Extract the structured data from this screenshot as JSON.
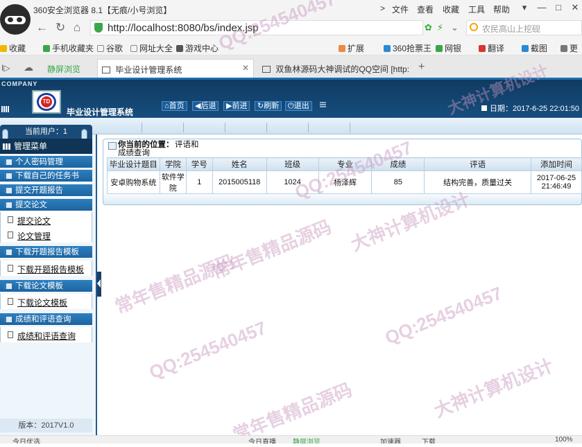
{
  "browser": {
    "window_title": "360安全浏览器 8.1【无痕/小号浏览】",
    "menu": [
      "文件",
      "查看",
      "收藏",
      "工具",
      "帮助"
    ],
    "window_buttons": [
      "▾",
      "—",
      "□",
      "✕"
    ],
    "address": "http://localhost:8080/bs/index.jsp",
    "search_placeholder": "农民高山上挖砚",
    "bookmarks": [
      "收藏",
      "手机收藏夹",
      "谷歌",
      "网址大全",
      "游戏中心",
      "扩展",
      "360抢票王",
      "网银",
      "翻译",
      "截图",
      "更多"
    ],
    "tabs": [
      {
        "label": "静屏浏览"
      },
      {
        "label": "毕业设计管理系统"
      },
      {
        "label": "双鱼林源码大神调试的QQ空间 [http:"
      }
    ],
    "status_items": [
      "今日优选",
      "今日直播",
      "静屏浏览",
      "加速器",
      "下载",
      "100%"
    ]
  },
  "app": {
    "company": "COMPANY",
    "logo_text": "TD",
    "system_name": "毕业设计管理系统",
    "header_buttons": [
      "首页",
      "后退",
      "前进",
      "刷新",
      "退出"
    ],
    "datetime": "日期：2017-6-25 22:01:50"
  },
  "sidebar": {
    "current_user": "当前用户：1",
    "menu_title": "管理菜单",
    "groups": [
      {
        "label": "个人密码管理"
      },
      {
        "label": "下载自己的任务书"
      },
      {
        "label": "提交开题报告"
      },
      {
        "label": "提交论文"
      },
      {
        "label": "下载开题报告模板"
      },
      {
        "label": "下载论文模板"
      },
      {
        "label": "成绩和评语查询"
      }
    ],
    "links": [
      "提交论文",
      "论文管理",
      "下载开题报告模板",
      "下载论文模板",
      "成绩和评语查询"
    ],
    "version": "版本：2017V1.0"
  },
  "main": {
    "crumb_prefix": "你当前的位置：",
    "crumb_part1": "评语和",
    "crumb_part2": "成绩查询",
    "columns": [
      "毕业设计题目",
      "学院",
      "学号",
      "姓名",
      "班级",
      "专业",
      "成绩",
      "评语",
      "添加时间"
    ],
    "rows": [
      [
        "安卓购物系统",
        "软件学院",
        "1",
        "2015005118",
        "1024",
        "杨泽辉",
        "85",
        "结构完善，质量过关",
        "2017-06-25 21:46:49"
      ]
    ]
  },
  "watermarks": [
    "QQ:254540457",
    "大神计算机设计",
    "常年售精品源码",
    "QQ:254540457",
    "大神计算机设计",
    "常年售精品源码",
    "QQ:254540457",
    "QQ:254540457",
    "大神计算机设计",
    "常年售精品源码"
  ]
}
